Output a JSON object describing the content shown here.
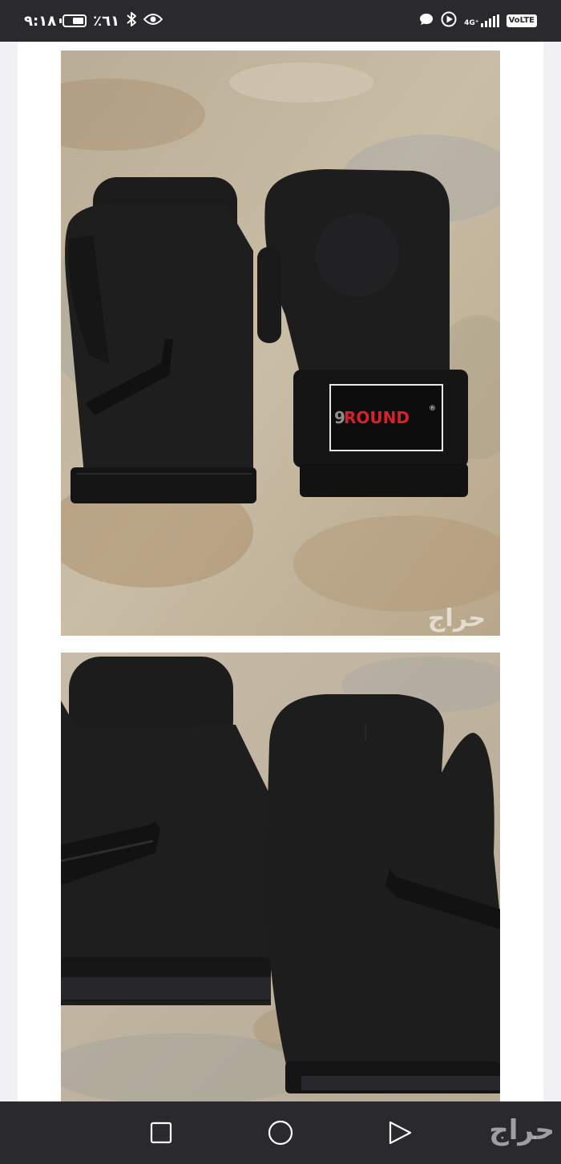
{
  "status_bar": {
    "time": "٩:١٨",
    "battery_text": "٪٦١",
    "battery_level": 0.61,
    "network_label": "4G⁺",
    "volte_label": "VoLTE",
    "left_icons": [
      "battery-icon",
      "bluetooth-icon",
      "eye-icon"
    ],
    "right_icons": [
      "chat-bubble-icon",
      "play-circle-icon",
      "signal-icon",
      "volte-icon"
    ]
  },
  "listing": {
    "photo_watermark": "حراج",
    "product_logo": "9ROUND",
    "product_logo_mark": "®"
  },
  "nav_bar": {
    "buttons": [
      "recents-button",
      "home-button",
      "back-button"
    ],
    "brand_watermark": "حراج"
  },
  "colors": {
    "status_bar_bg": "#2a2a2e",
    "nav_bar_bg": "#2a2a2e",
    "page_bg": "#f1f1f3",
    "card_bg": "#ffffff",
    "glove_black": "#1c1c1d",
    "logo_red": "#d8202a"
  }
}
